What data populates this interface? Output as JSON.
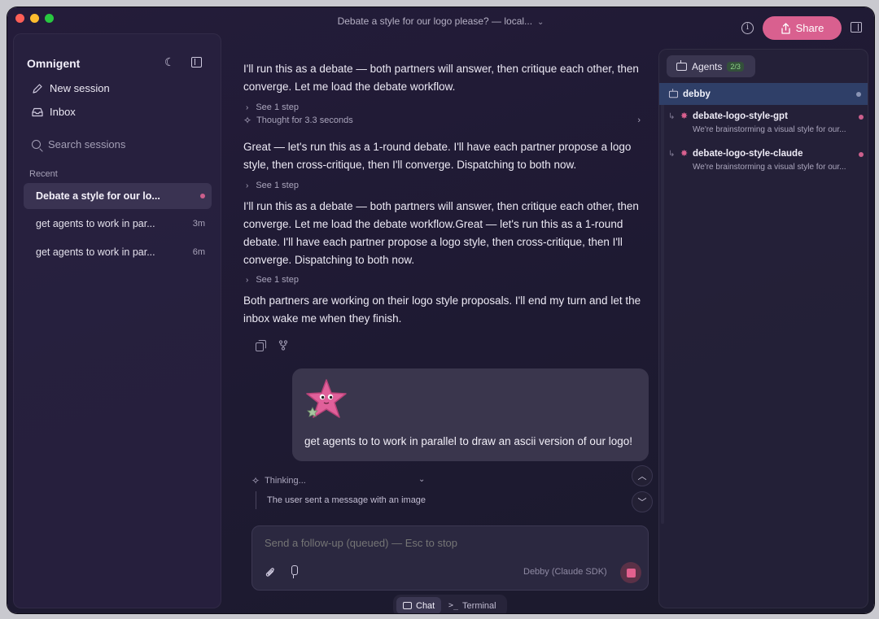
{
  "window": {
    "title": "Debate a style for our logo please? — local...",
    "share_label": "Share"
  },
  "sidebar": {
    "brand": "Omnigent",
    "new_session": "New session",
    "inbox": "Inbox",
    "search_placeholder": "Search sessions",
    "recent_label": "Recent",
    "sessions": [
      {
        "title": "Debate a style for our lo...",
        "age": ""
      },
      {
        "title": "get agents to work in par...",
        "age": "3m"
      },
      {
        "title": "get agents to work in par...",
        "age": "6m"
      }
    ]
  },
  "chat": {
    "messages": [
      "I'll run this as a debate — both partners will answer, then critique each other, then converge. Let me load the debate workflow.",
      "Great — let's run this as a 1-round debate. I'll have each partner propose a logo style, then cross-critique, then I'll converge. Dispatching to both now.",
      "I'll run this as a debate — both partners will answer, then critique each other, then converge. Let me load the debate workflow.Great — let's run this as a 1-round debate. I'll have each partner propose a logo style, then cross-critique, then I'll converge. Dispatching to both now.",
      "Both partners are working on their logo style proposals. I'll end my turn and let the inbox wake me when they finish."
    ],
    "see_step": "See 1 step",
    "thought": "Thought for 3.3 seconds",
    "user_message": "get agents to to work in parallel to draw an ascii version of our logo!",
    "thinking_label": "Thinking...",
    "thinking_detail": "The user sent a message with an image"
  },
  "composer": {
    "placeholder": "Send a follow-up (queued) — Esc to stop",
    "model": "Debby (Claude SDK)"
  },
  "mode_tabs": {
    "chat": "Chat",
    "terminal": "Terminal"
  },
  "agents": {
    "tab_label": "Agents",
    "count": "2/3",
    "root": "debby",
    "children": [
      {
        "name": "debate-logo-style-gpt",
        "desc": "We're brainstorming a visual style for our..."
      },
      {
        "name": "debate-logo-style-claude",
        "desc": "We're brainstorming a visual style for our..."
      }
    ]
  },
  "colors": {
    "accent": "#d9608f",
    "background": "#1e1a32",
    "active_agent": "#2f3f68"
  }
}
